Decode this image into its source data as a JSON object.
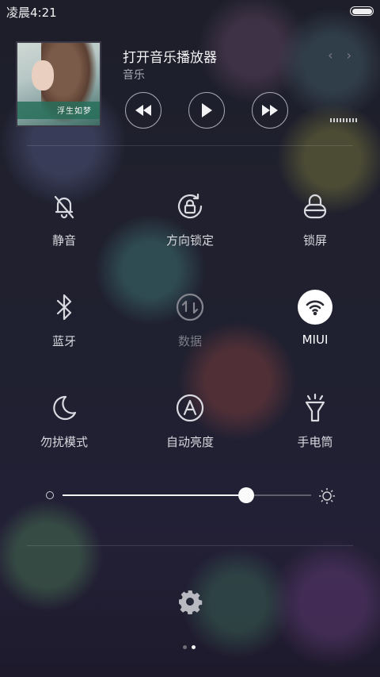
{
  "status_bar": {
    "time": "凌晨4:21"
  },
  "music": {
    "title": "打开音乐播放器",
    "subtitle": "音乐",
    "album_caption": "浮生如梦",
    "nav_arrows": "‹ ›",
    "controls": [
      "previous-icon",
      "play-icon",
      "next-icon"
    ]
  },
  "toggles": [
    {
      "label": "静音",
      "icon": "bell-off-icon",
      "state": "off"
    },
    {
      "label": "方向锁定",
      "icon": "rotation-lock-icon",
      "state": "off"
    },
    {
      "label": "锁屏",
      "icon": "lock-icon",
      "state": "off"
    },
    {
      "label": "蓝牙",
      "icon": "bluetooth-icon",
      "state": "off"
    },
    {
      "label": "数据",
      "icon": "mobile-data-icon",
      "state": "disabled"
    },
    {
      "label": "MIUI",
      "icon": "wifi-icon",
      "state": "on"
    },
    {
      "label": "勿扰模式",
      "icon": "moon-icon",
      "state": "off"
    },
    {
      "label": "自动亮度",
      "icon": "auto-brightness-icon",
      "state": "off"
    },
    {
      "label": "手电筒",
      "icon": "flashlight-icon",
      "state": "off"
    }
  ],
  "brightness": {
    "level": 0.74
  },
  "page_indicator": {
    "count": 2,
    "active_index": 1
  },
  "colors": {
    "active_toggle_bg": "#ffffff",
    "text_primary": "#e9e9ee",
    "text_disabled": "#7c7c86"
  }
}
